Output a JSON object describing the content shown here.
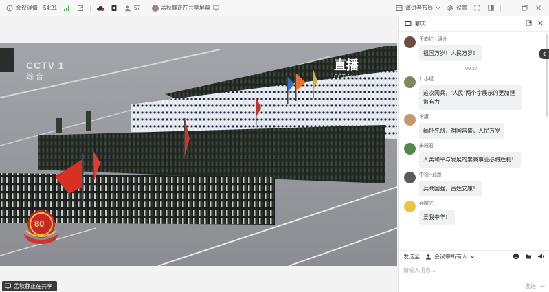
{
  "topbar": {
    "meeting_details": "会议详情",
    "timer": "54:21",
    "participants_count": "57",
    "sharing_status": "孟秋静正在共享屏幕",
    "layout_label": "演讲者布局",
    "settings_label": "设置"
  },
  "video": {
    "channel_logo": "CCTV 1",
    "channel_sub": "综合",
    "live_label": "直播",
    "live_sub": "CCTV.com",
    "badge_number": "80"
  },
  "bottombar": {
    "share_text": "孟秋静正在共享"
  },
  "chat": {
    "title": "聊天",
    "timestamp": "09:27",
    "messages": [
      {
        "name": "王向红 - 温州",
        "text": "祖国万岁！人民万岁！",
        "avatar_color": "#6b4e3d"
      },
      {
        "name": "！小斌",
        "text": "这次阅兵，“人民”两个字展示的更加铿锵有力",
        "avatar_color": "#7a8a5a"
      },
      {
        "name": "李康",
        "text": "缅怀先烈，祖国昌盛，人民万岁",
        "avatar_color": "#c49a6c"
      },
      {
        "name": "朱殿君",
        "text": "人类和平与发展的崇高事业必将胜利！",
        "avatar_color": "#4f8a4c"
      },
      {
        "name": "中德--孔慧",
        "text": "兵劲国强，百姓安康！",
        "avatar_color": "#5a5a5a"
      },
      {
        "name": "孙曙光",
        "text": "爱我中华！",
        "avatar_color": "#e8c640"
      }
    ],
    "send_to_label": "发送至",
    "send_target": "会议中所有人",
    "input_placeholder": "请输入消息...",
    "send_button": "发送"
  }
}
